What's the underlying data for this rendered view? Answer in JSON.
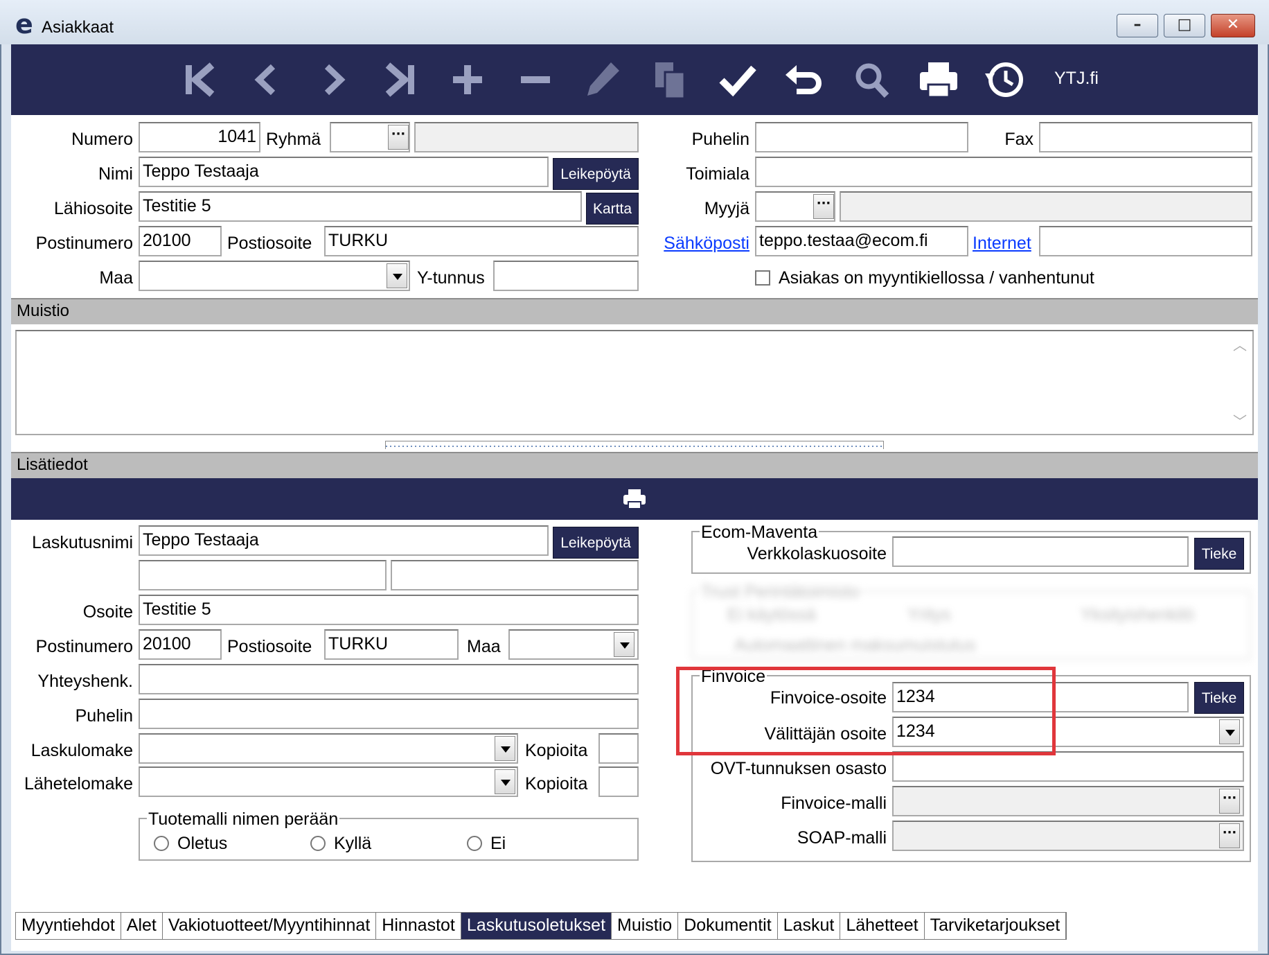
{
  "window": {
    "title": "Asiakkaat",
    "app_logo": "e",
    "buttons": [
      "minimize",
      "maximize",
      "close"
    ]
  },
  "toolbar": {
    "icons": [
      "first-record-icon",
      "previous-record-icon",
      "next-record-icon",
      "last-record-icon",
      "add-icon",
      "delete-icon",
      "edit-icon",
      "copy-icon",
      "save-check-icon",
      "undo-icon",
      "search-icon",
      "print-icon",
      "history-icon"
    ],
    "ytj_label": "YTJ.fi"
  },
  "customer": {
    "numero_label": "Numero",
    "numero": "1041",
    "ryhma_label": "Ryhmä",
    "ryhma": "",
    "ryhma_name": "",
    "nimi_label": "Nimi",
    "nimi": "Teppo Testaaja",
    "leikepoyta_label": "Leikepöytä",
    "lahiosoite_label": "Lähiosoite",
    "lahiosoite": "Testitie 5",
    "kartta_label": "Kartta",
    "postinumero_label": "Postinumero",
    "postinumero": "20100",
    "postiosoite_label": "Postiosoite",
    "postiosoite": "TURKU",
    "maa_label": "Maa",
    "maa": "",
    "ytunnus_label": "Y-tunnus",
    "ytunnus": "",
    "puhelin_label": "Puhelin",
    "puhelin": "",
    "fax_label": "Fax",
    "fax": "",
    "toimiala_label": "Toimiala",
    "toimiala": "",
    "myyja_label": "Myyjä",
    "myyja": "",
    "myyja_name": "",
    "sahkoposti_label": "Sähköposti",
    "sahkoposti": "teppo.testaa@ecom.fi",
    "internet_label": "Internet",
    "internet": "",
    "sales_ban_label": "Asiakas on myyntikiellossa / vanhentunut",
    "sales_ban_checked": false
  },
  "muistio": {
    "header": "Muistio",
    "text": ""
  },
  "lisatiedot": {
    "header": "Lisätiedot",
    "laskutusnimi_label": "Laskutusnimi",
    "laskutusnimi": "Teppo Testaaja",
    "leikepoyta_label": "Leikepöytä",
    "extra1": "",
    "extra2": "",
    "osoite_label": "Osoite",
    "osoite": "Testitie 5",
    "postinumero_label": "Postinumero",
    "postinumero": "20100",
    "postiosoite_label": "Postiosoite",
    "postiosoite": "TURKU",
    "maa_label": "Maa",
    "maa": "",
    "yhteyshenk_label": "Yhteyshenk.",
    "yhteyshenk": "",
    "puhelin_label": "Puhelin",
    "puhelin": "",
    "laskulomake_label": "Laskulomake",
    "laskulomake": "",
    "kopioita_label": "Kopioita",
    "kopioita1": "",
    "lahetelomake_label": "Lähetelomake",
    "kopioita2": "",
    "tuotemalli_title": "Tuotemalli nimen perään",
    "tuotemalli_options": [
      "Oletus",
      "Kyllä",
      "Ei"
    ],
    "ecom": {
      "title": "Ecom-Maventa",
      "verkkolaskuosoite_label": "Verkkolaskuosoite",
      "verkkolaskuosoite": "",
      "tieke_label": "Tieke"
    },
    "trust": {
      "title": "Trust Perintätoimisto",
      "options": [
        "Ei käytössä",
        "Yritys",
        "Yksityishenkilö"
      ],
      "auto_label": "Automaattinen maksumuistutus"
    },
    "finvoice": {
      "title": "Finvoice",
      "osoite_label": "Finvoice-osoite",
      "osoite": "1234",
      "tieke_label": "Tieke",
      "valittaja_label": "Välittäjän osoite",
      "valittaja": "1234",
      "ovt_label": "OVT-tunnuksen osasto",
      "ovt": "",
      "malli_label": "Finvoice-malli",
      "malli": "",
      "soap_label": "SOAP-malli",
      "soap": ""
    }
  },
  "tabs": [
    "Myyntiehdot",
    "Alet",
    "Vakiotuotteet/Myyntihinnat",
    "Hinnastot",
    "Laskutusoletukset",
    "Muistio",
    "Dokumentit",
    "Laskut",
    "Lähetteet",
    "Tarviketarjoukset"
  ],
  "active_tab": "Laskutusoletukset",
  "colors": {
    "navy": "#262a55",
    "highlight": "#e0363b",
    "link": "#0a3bff"
  }
}
